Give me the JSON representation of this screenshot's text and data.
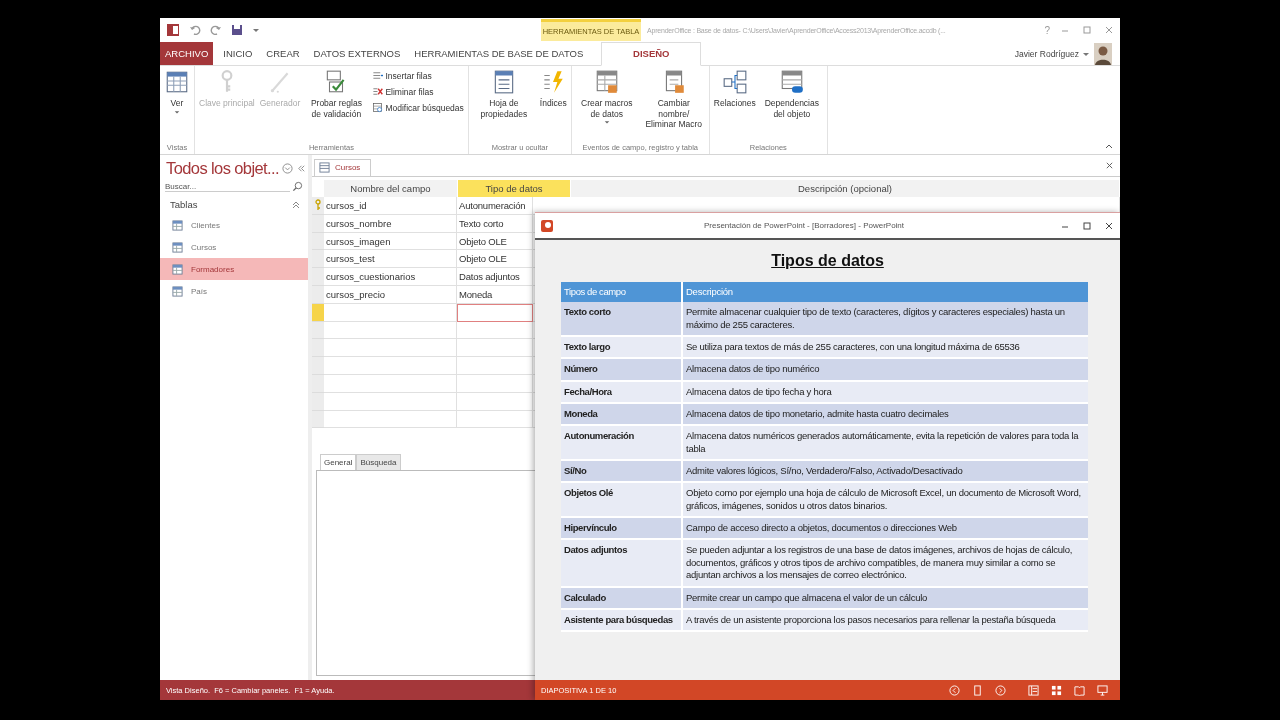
{
  "access_window": {
    "title": "AprenderOffice : Base de datos- C:\\Users\\Javier\\AprenderOffice\\Access2013\\AprenderOffice.accdb (...",
    "contextual_tab_group": "HERRAMIENTAS DE TABLA",
    "help_button": "?",
    "user": "Javier Rodríguez",
    "ribbon_tabs": [
      {
        "label": "ARCHIVO",
        "kind": "file",
        "selected": false
      },
      {
        "label": "INICIO",
        "kind": "tab",
        "selected": false
      },
      {
        "label": "CREAR",
        "kind": "tab",
        "selected": false
      },
      {
        "label": "DATOS EXTERNOS",
        "kind": "tab",
        "selected": false
      },
      {
        "label": "HERRAMIENTAS DE BASE DE DATOS",
        "kind": "tab",
        "selected": false
      },
      {
        "label": "DISEÑO",
        "kind": "contextual",
        "selected": true
      }
    ],
    "ribbon_groups": [
      {
        "label": "Vistas",
        "commands": [
          {
            "label": "Ver",
            "kind": "large",
            "dropdown": true,
            "disabled": false
          }
        ]
      },
      {
        "label": "Herramientas",
        "commands": [
          {
            "label": "Clave principal",
            "kind": "large",
            "dropdown": false,
            "disabled": true
          },
          {
            "label": "Generador",
            "kind": "large",
            "dropdown": false,
            "disabled": true
          },
          {
            "label": "Probar reglas de validación",
            "kind": "large",
            "dropdown": false,
            "disabled": false
          },
          {
            "label": "Insertar filas",
            "kind": "small",
            "disabled": false
          },
          {
            "label": "Eliminar filas",
            "kind": "small",
            "disabled": false
          },
          {
            "label": "Modificar búsquedas",
            "kind": "small",
            "disabled": false
          }
        ]
      },
      {
        "label": "Mostrar u ocultar",
        "commands": [
          {
            "label": "Hoja de propiedades",
            "kind": "large",
            "dropdown": false,
            "disabled": false
          },
          {
            "label": "Índices",
            "kind": "large",
            "dropdown": false,
            "disabled": false
          }
        ]
      },
      {
        "label": "Eventos de campo, registro y tabla",
        "commands": [
          {
            "label": "Crear macros de datos",
            "kind": "large",
            "dropdown": true,
            "disabled": false
          },
          {
            "label": "Cambiar nombre/ Eliminar Macro",
            "kind": "large",
            "dropdown": false,
            "disabled": false
          }
        ]
      },
      {
        "label": "Relaciones",
        "commands": [
          {
            "label": "Relaciones",
            "kind": "large",
            "dropdown": false,
            "disabled": false
          },
          {
            "label": "Dependencias del objeto",
            "kind": "large",
            "dropdown": false,
            "disabled": false
          }
        ]
      }
    ],
    "nav_pane": {
      "title": "Todos los objet...",
      "search_placeholder": "Buscar...",
      "section": "Tablas",
      "items": [
        {
          "label": "Clientes",
          "selected": false
        },
        {
          "label": "Cursos",
          "selected": false
        },
        {
          "label": "Formadores",
          "selected": true
        },
        {
          "label": "País",
          "selected": false
        }
      ]
    },
    "document": {
      "tab": "Cursos",
      "columns": [
        {
          "label": "Nombre del campo",
          "selected": false
        },
        {
          "label": "Tipo de datos",
          "selected": true
        },
        {
          "label": "Descripción (opcional)",
          "selected": false
        }
      ],
      "rows": [
        {
          "name": "cursos_id",
          "type": "Autonumeración",
          "primary_key": true,
          "current": false
        },
        {
          "name": "cursos_nombre",
          "type": "Texto corto",
          "primary_key": false,
          "current": false
        },
        {
          "name": "cursos_imagen",
          "type": "Objeto OLE",
          "primary_key": false,
          "current": false
        },
        {
          "name": "cursos_test",
          "type": "Objeto OLE",
          "primary_key": false,
          "current": false
        },
        {
          "name": "cursos_cuestionarios",
          "type": "Datos adjuntos",
          "primary_key": false,
          "current": false
        },
        {
          "name": "cursos_precio",
          "type": "Moneda",
          "primary_key": false,
          "current": false
        },
        {
          "primary_key": false,
          "current": true
        }
      ],
      "property_tabs": [
        {
          "label": "General",
          "selected": true
        },
        {
          "label": "Búsqueda",
          "selected": false
        }
      ]
    },
    "status_bar": "Vista Diseño.  F6 = Cambiar paneles.  F1 = Ayuda."
  },
  "powerpoint_window": {
    "title": "Presentación de PowerPoint - [Borradores] - PowerPoint",
    "slide": {
      "title": "Tipos de datos",
      "columns": [
        "Tipos de campo",
        "Descripción"
      ],
      "rows": [
        {
          "field": "Texto corto",
          "description": "Permite almacenar cualquier tipo de texto (caracteres, dígitos y caracteres especiales) hasta un máximo de 255 caracteres."
        },
        {
          "field": "Texto largo",
          "description": "Se utiliza para textos de más de 255 caracteres, con una longitud máxima de 65536"
        },
        {
          "field": "Número",
          "description": "Almacena datos de tipo numérico"
        },
        {
          "field": "Fecha/Hora",
          "description": "Almacena datos de tipo fecha y hora"
        },
        {
          "field": "Moneda",
          "description": "Almacena datos de tipo monetario, admite hasta cuatro decimales"
        },
        {
          "field": "Autonumeración",
          "description": "Almacena datos numéricos generados automáticamente, evita la repetición de valores para toda la tabla"
        },
        {
          "field": "Sí/No",
          "description": "Admite valores lógicos, Sí/no, Verdadero/Falso, Activado/Desactivado"
        },
        {
          "field": "Objetos Olé",
          "description": "Objeto como por ejemplo una hoja de cálculo de Microsoft Excel, un documento de Microsoft Word, gráficos, imágenes, sonidos u otros datos binarios."
        },
        {
          "field": "Hipervínculo",
          "description": "Campo de acceso directo a objetos, documentos o direcciones Web"
        },
        {
          "field": "Datos adjuntos",
          "description": "Se pueden adjuntar a los registros de una base de datos imágenes, archivos de hojas de cálculo, documentos, gráficos y otros tipos de archivo compatibles, de manera muy similar a como se adjuntan archivos a los mensajes de correo electrónico."
        },
        {
          "field": "Calculado",
          "description": "Permite crear un campo que almacena el valor de un cálculo"
        },
        {
          "field": "Asistente para búsquedas",
          "description": "A través de un asistente proporciona los pasos necesarios para rellenar la pestaña búsqueda"
        }
      ]
    },
    "status": "DIAPOSITIVA 1 DE 10"
  }
}
